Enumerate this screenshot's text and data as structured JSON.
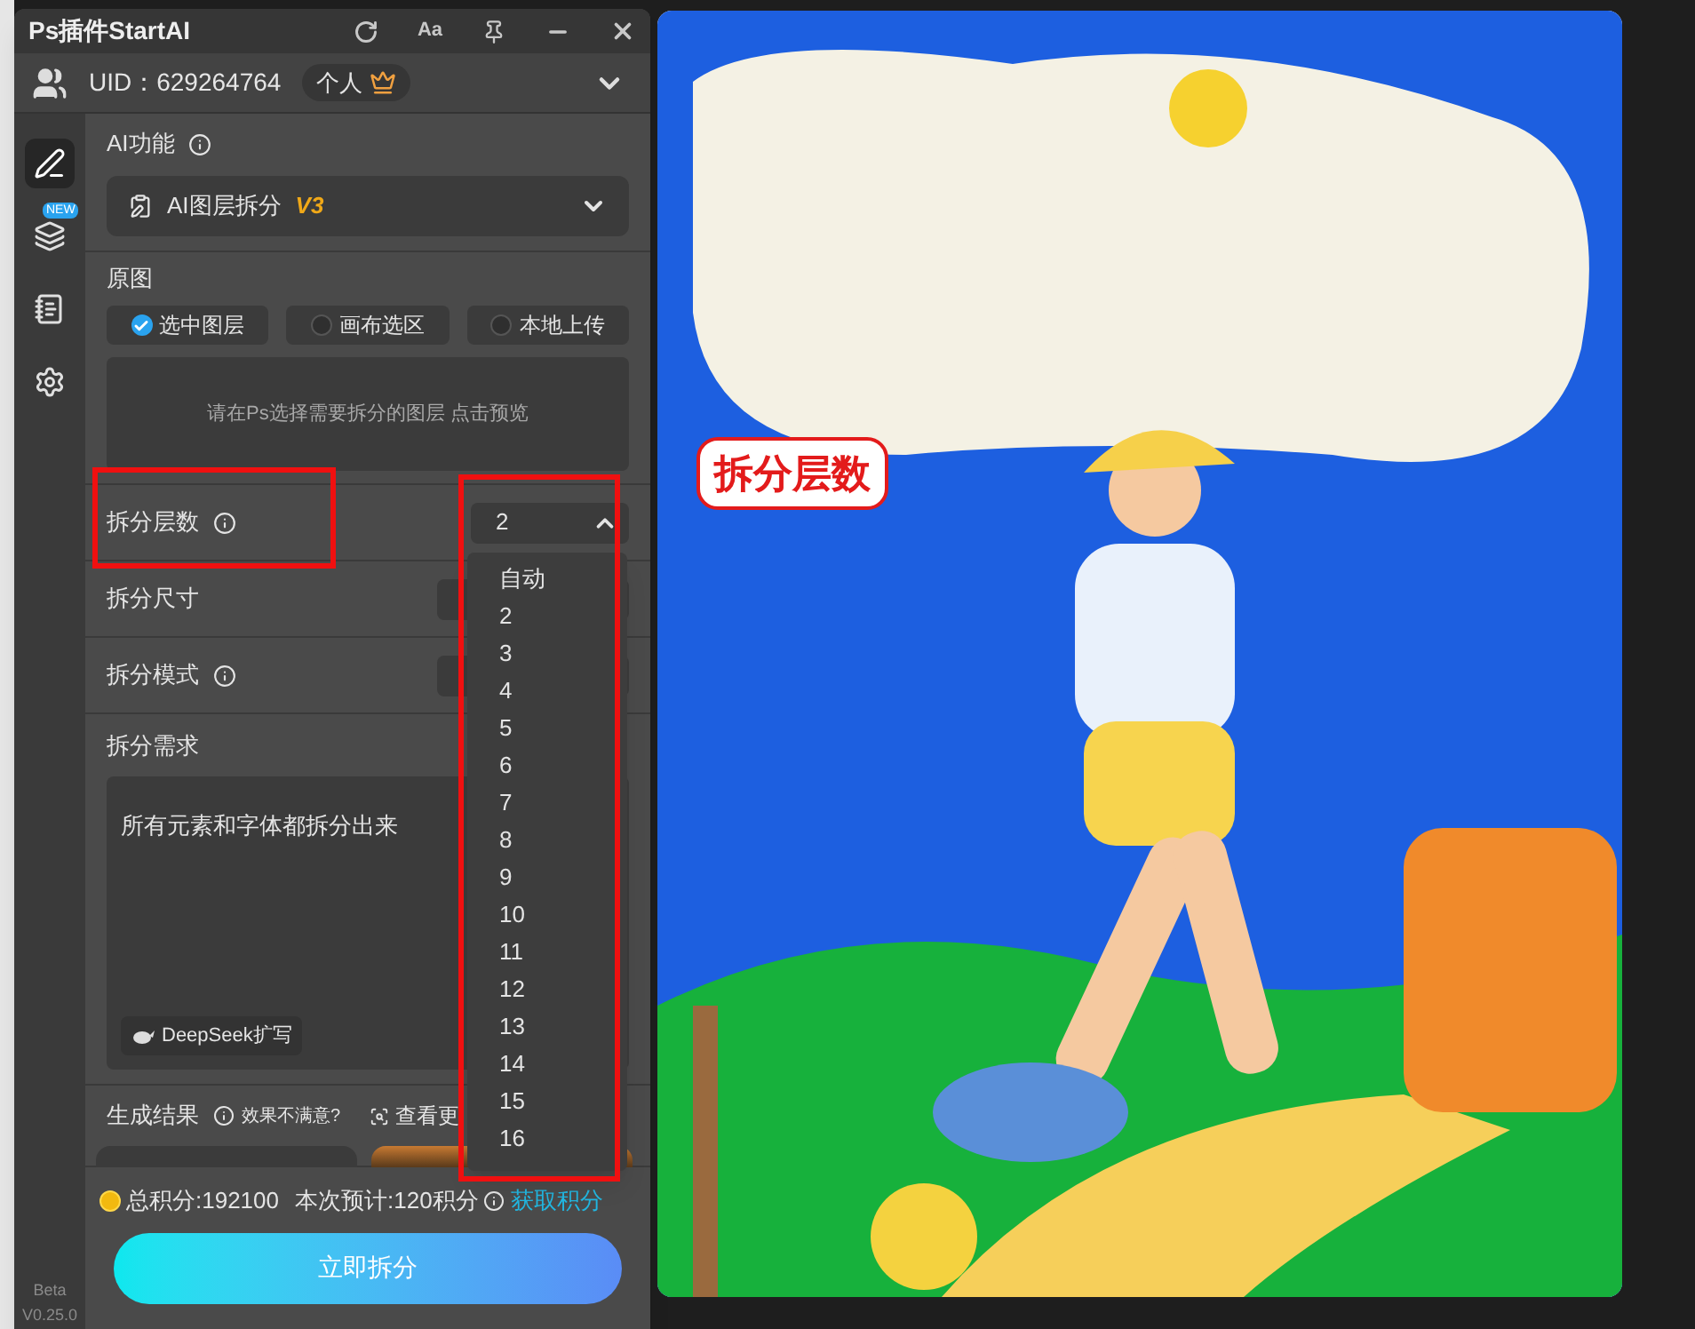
{
  "window": {
    "title": "Ps插件StartAI",
    "font_button": "Aa"
  },
  "account": {
    "uid": "UID：629264764",
    "plan": "个人"
  },
  "sidebar": {
    "items": [
      {
        "kind": "edit",
        "selected": true
      },
      {
        "kind": "layers",
        "selected": false,
        "badge": "NEW"
      },
      {
        "kind": "document",
        "selected": false
      },
      {
        "kind": "settings",
        "selected": false
      }
    ],
    "version": [
      "Beta",
      "V0.25.0"
    ]
  },
  "ai_function": {
    "label": "AI功能",
    "value": "AI图层拆分",
    "tag": "V3"
  },
  "source": {
    "label": "原图",
    "options": [
      {
        "label": "选中图层",
        "selected": true
      },
      {
        "label": "画布选区",
        "selected": false
      },
      {
        "label": "本地上传",
        "selected": false
      }
    ],
    "hint": "请在Ps选择需要拆分的图层 点击预览"
  },
  "settings": [
    {
      "label": "拆分层数",
      "info": true,
      "value": "2",
      "expanded": true
    },
    {
      "label": "拆分尺寸",
      "info": false,
      "expanded": false
    },
    {
      "label": "拆分模式",
      "info": true,
      "expanded": false
    }
  ],
  "layer_options": [
    "自动",
    "2",
    "3",
    "4",
    "5",
    "6",
    "7",
    "8",
    "9",
    "10",
    "11",
    "12",
    "13",
    "14",
    "15",
    "16"
  ],
  "requirement": {
    "label": "拆分需求",
    "value": "所有元素和字体都拆分出来",
    "expand_button": "DeepSeek扩写"
  },
  "results": {
    "label": "生成结果",
    "feedback": "效果不满意?",
    "more": "查看更"
  },
  "footer": {
    "total": "总积分:192100",
    "estimate": "本次预计:120积分",
    "link": "获取积分"
  },
  "action_button": "立即拆分",
  "annotation": {
    "label": "拆分层数"
  }
}
